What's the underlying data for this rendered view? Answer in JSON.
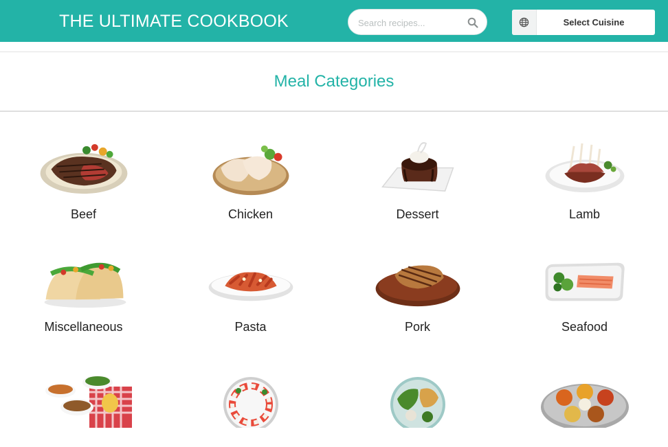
{
  "header": {
    "brand": "THE ULTIMATE COOKBOOK",
    "search_placeholder": "Search recipes...",
    "cuisine_label": "Select Cuisine"
  },
  "section": {
    "title": "Meal Categories"
  },
  "categories": [
    {
      "label": "Beef",
      "icon": "beef-dish-icon"
    },
    {
      "label": "Chicken",
      "icon": "chicken-dish-icon"
    },
    {
      "label": "Dessert",
      "icon": "dessert-dish-icon"
    },
    {
      "label": "Lamb",
      "icon": "lamb-dish-icon"
    },
    {
      "label": "Miscellaneous",
      "icon": "tacos-dish-icon"
    },
    {
      "label": "Pasta",
      "icon": "pasta-dish-icon"
    },
    {
      "label": "Pork",
      "icon": "pork-dish-icon"
    },
    {
      "label": "Seafood",
      "icon": "seafood-dish-icon"
    },
    {
      "label": "",
      "icon": "side-dish-icon"
    },
    {
      "label": "",
      "icon": "starter-dish-icon"
    },
    {
      "label": "",
      "icon": "vegan-dish-icon"
    },
    {
      "label": "",
      "icon": "vegetarian-dish-icon"
    }
  ],
  "colors": {
    "accent": "#23b3a7"
  }
}
